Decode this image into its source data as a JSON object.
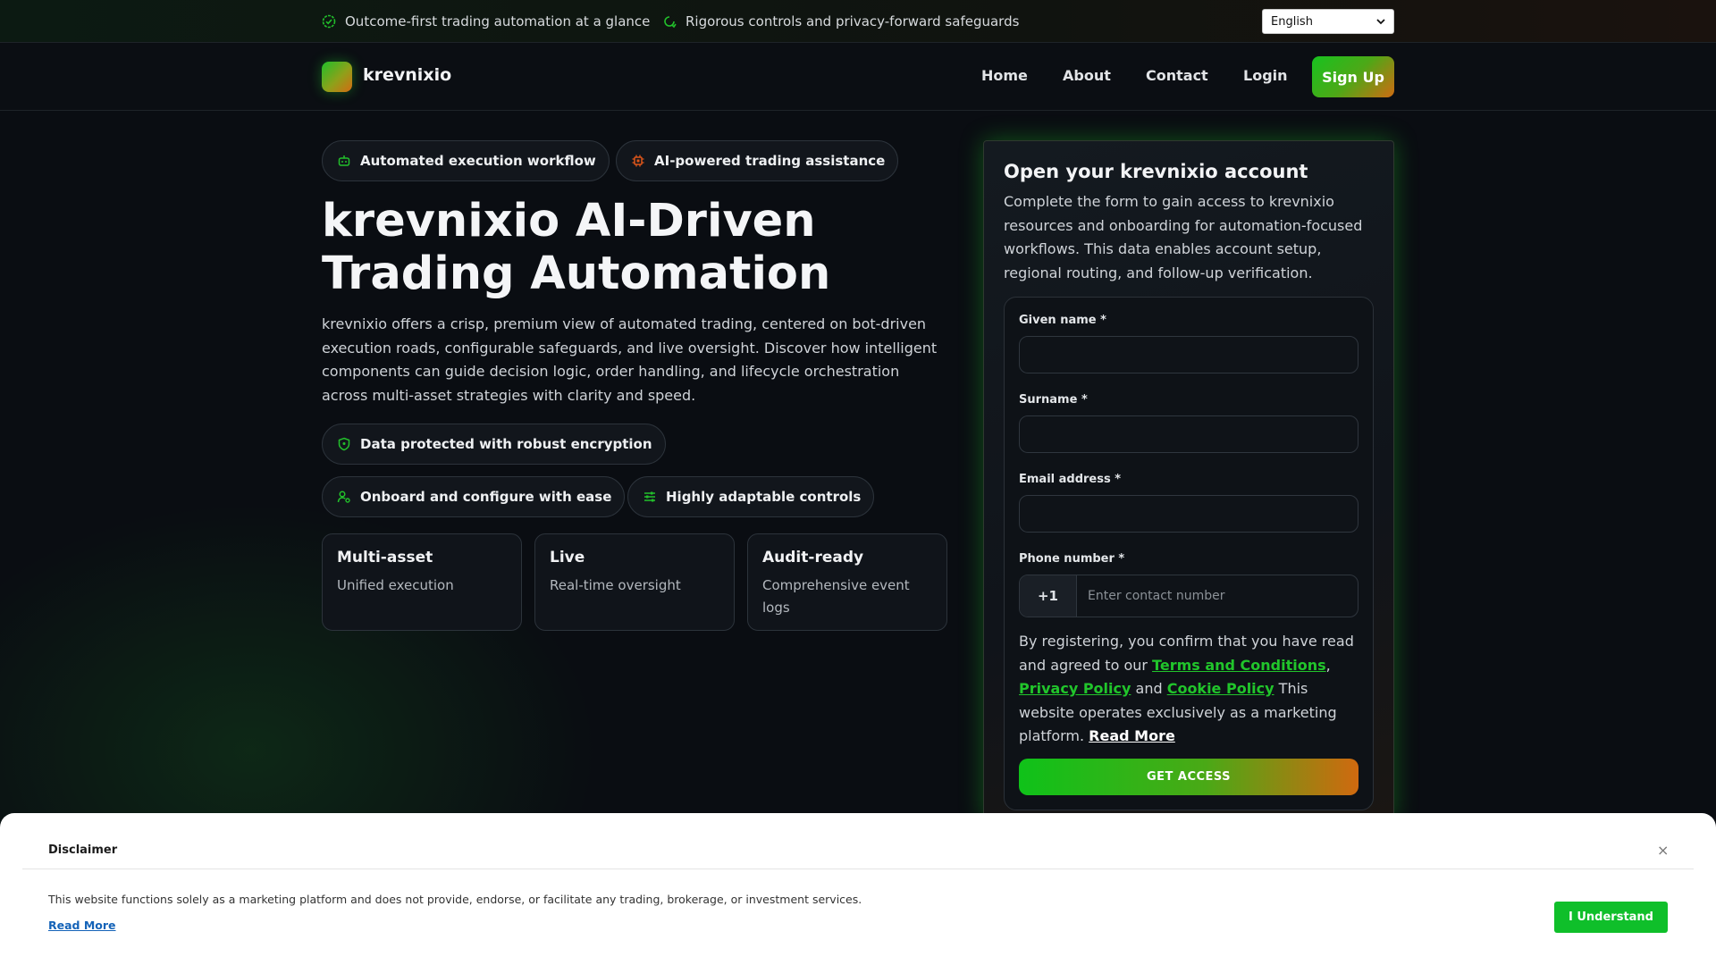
{
  "topbar": {
    "item1": "Outcome-first trading automation at a glance",
    "item2": "Rigorous controls and privacy-forward safeguards",
    "language": "English"
  },
  "nav": {
    "brand": "krevnixio",
    "links": [
      "Home",
      "About",
      "Contact",
      "Login"
    ],
    "signup": "Sign Up"
  },
  "hero": {
    "pills": [
      "Automated execution workflow",
      "AI-powered trading assistance"
    ],
    "title": "krevnixio AI-Driven Trading Automation",
    "description": "krevnixio offers a crisp, premium view of automated trading, centered on bot-driven execution roads, configurable safeguards, and live oversight. Discover how intelligent components can guide decision logic, order handling, and lifecycle orchestration across multi-asset strategies with clarity and speed.",
    "features": [
      "Data protected with robust encryption",
      "Onboard and configure with ease",
      "Highly adaptable controls"
    ],
    "stats": [
      {
        "title": "Multi-asset",
        "subtitle": "Unified execution"
      },
      {
        "title": "Live",
        "subtitle": "Real-time oversight"
      },
      {
        "title": "Audit-ready",
        "subtitle": "Comprehensive event logs"
      }
    ]
  },
  "form": {
    "title": "Open your krevnixio account",
    "subtitle": "Complete the form to gain access to krevnixio resources and onboarding for automation-focused workflows. This data enables account setup, regional routing, and follow-up verification.",
    "given_name_label": "Given name *",
    "surname_label": "Surname *",
    "email_label": "Email address *",
    "phone_label": "Phone number *",
    "phone_code": "+1",
    "phone_placeholder": "Enter contact number",
    "consent_prefix": "By registering, you confirm that you have read and agreed to our ",
    "terms": "Terms and Conditions",
    "privacy": "Privacy Policy",
    "and": " and ",
    "cookie": "Cookie Policy",
    "consent_suffix": " This website operates exclusively as a marketing platform. ",
    "read_more": "Read More",
    "submit": "GET ACCESS"
  },
  "disclaimer": {
    "title": "Disclaimer",
    "close": "×",
    "text": "This website functions solely as a marketing platform and does not provide, endorse, or facilitate any trading, brokerage, or investment services.",
    "read_more": "Read More",
    "button": "I Understand"
  },
  "colors": {
    "accent_green": "#17c21f",
    "accent_orange": "#cf6b12",
    "background": "#0a0d12"
  }
}
